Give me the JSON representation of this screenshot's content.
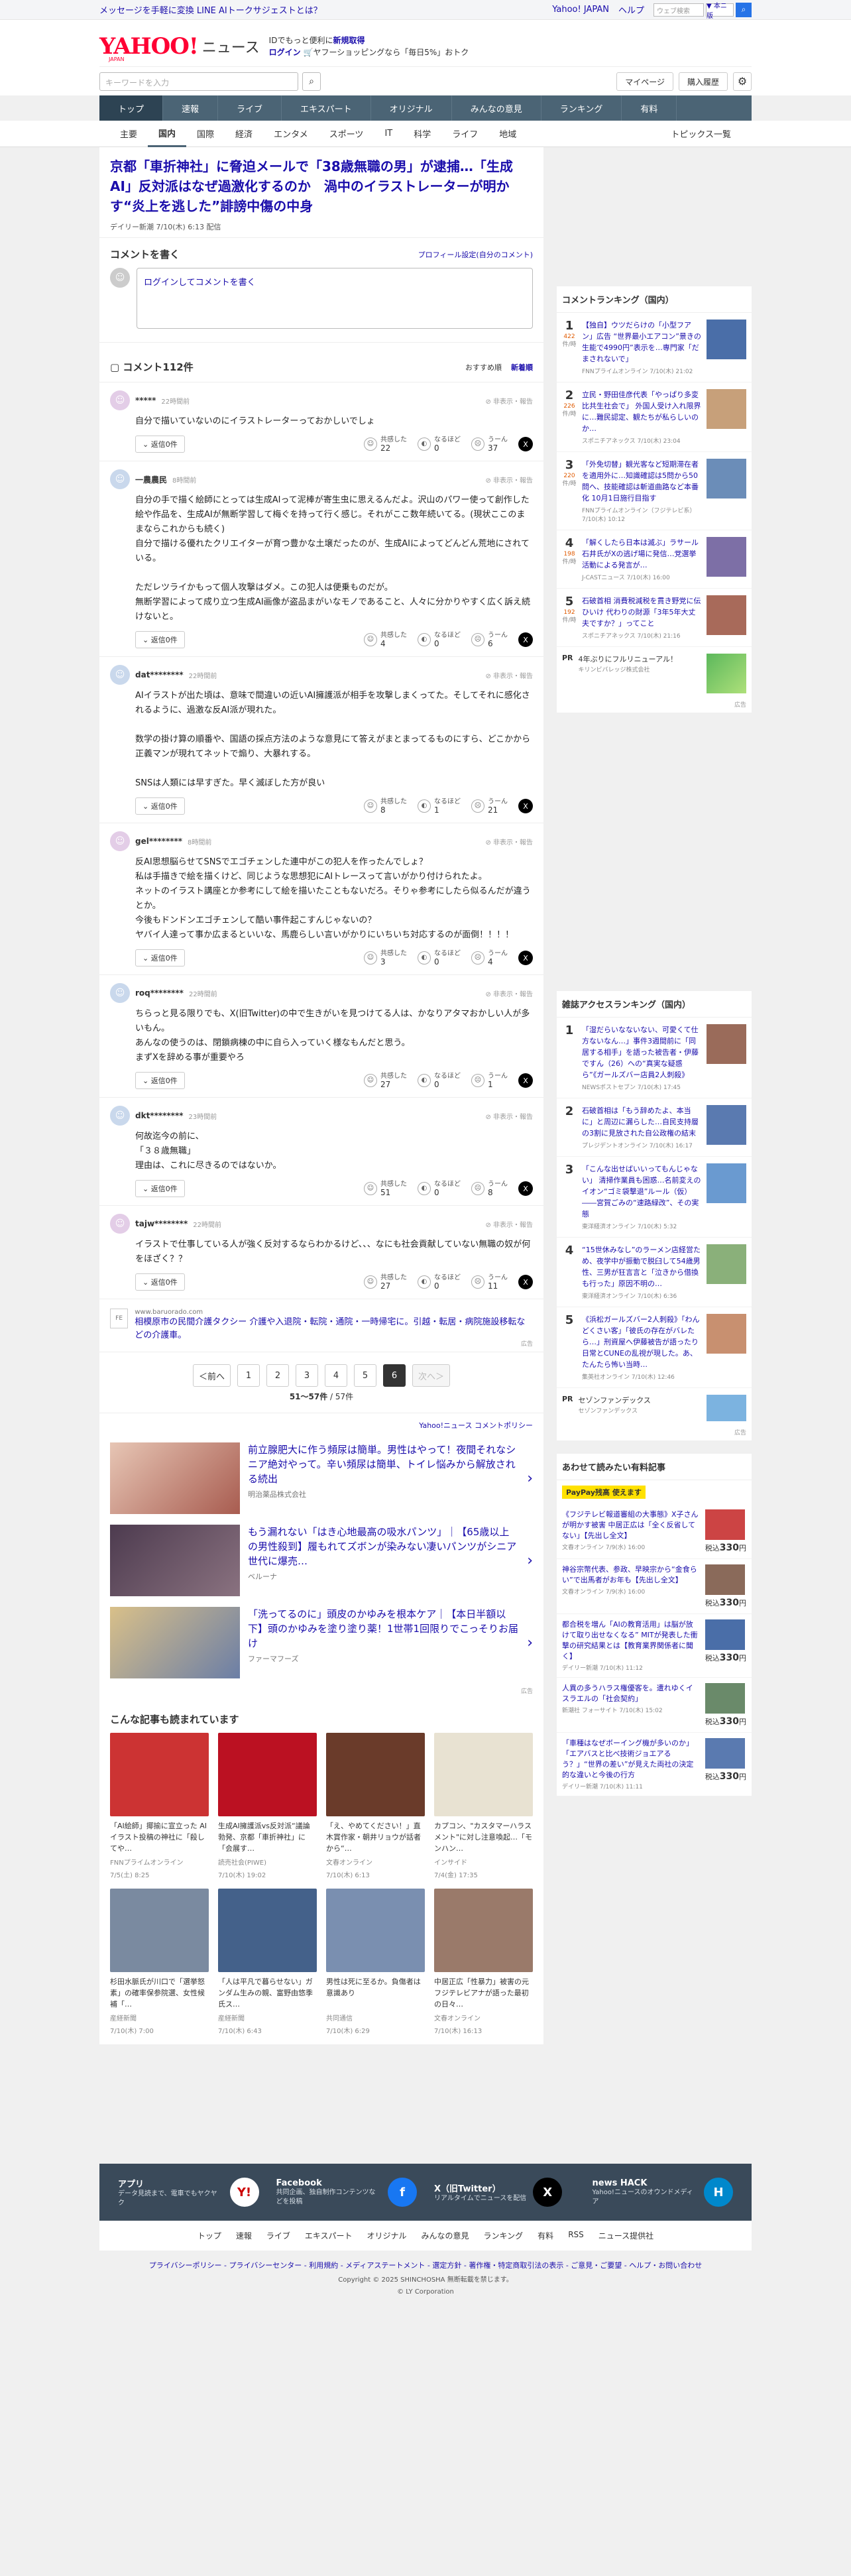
{
  "topbar": {
    "notice": "メッセージを手軽に変換 LINE AIトークサジェストとは？",
    "links": [
      "Yahoo! JAPAN",
      "ヘルプ"
    ],
    "search_placeholder": "ウェブ検索",
    "search_scope": "▼ 本ニ版",
    "search_go": "⌕"
  },
  "header": {
    "logo": "YAHOO!",
    "logo_sub": "JAPAN",
    "section": "ニュース",
    "promo_line1": "IDでもっと便利に",
    "promo_link1": "新規取得",
    "promo_line2_link": "ログイン",
    "promo_line2": "ヤフーショッピングなら「毎日5%」おトク",
    "search_placeholder": "キーワードを入力",
    "mypage": "マイページ",
    "history": "購入履歴"
  },
  "nav1": [
    "トップ",
    "速報",
    "ライブ",
    "エキスパート",
    "オリジナル",
    "みんなの意見",
    "ランキング",
    "有料"
  ],
  "nav2": [
    "主要",
    "国内",
    "国際",
    "経済",
    "エンタメ",
    "スポーツ",
    "IT",
    "科学",
    "ライフ",
    "地域"
  ],
  "nav2_right": "トピックス一覧",
  "article": {
    "title": "京都「車折神社」に脅迫メールで「38歳無職の男」が逮捕…「生成AI」反対派はなぜ過激化するのか　渦中のイラストレーターが明かす“炎上を逃した”誹謗中傷の中身",
    "source": "デイリー新潮 7/10(木) 6:13 配信"
  },
  "comment_write": {
    "title": "コメントを書く",
    "profile_link": "プロフィール設定(自分のコメント)",
    "placeholder": "ログインしてコメントを書く"
  },
  "comments_header": {
    "title": "コメント112件",
    "sort": [
      "おすすめ順",
      "新着順"
    ]
  },
  "labels": {
    "reply": "返信0件",
    "report": "非表示・報告",
    "agree": "共感した",
    "think": "なるほど",
    "hmm": "うーん"
  },
  "comments": [
    {
      "name": "*****",
      "time": "22時間前",
      "text": "自分で描いていないのにイラストレーターっておかしいでしょ",
      "v": [
        "22",
        "0",
        "37"
      ]
    },
    {
      "name": "一農農民",
      "time": "8時間前",
      "text": "自分の手で描く絵師にとっては生成AIって泥棒が寄生虫に思えるんだよ。沢山のパワー使って創作した絵や作品を、生成AIが無断学習して梅ぐを持って行く感じ。それがここ数年続いてる。(現状ここのままならこれからも続く)\n自分で描ける優れたクリエイターが育つ豊かな土壌だったのが、生成AIによってどんどん荒地にされている。\n\nただレツライかもって個人攻撃はダメ。この犯人は便乗ものだが。\n無断学習によって成り立つ生成AI画像が盗品まがいなモノであること、人々に分かりやすく広く訴え続けないと。",
      "v": [
        "4",
        "0",
        "6"
      ]
    },
    {
      "name": "dat********",
      "time": "22時間前",
      "text": "AIイラストが出た頃は、意味で間違いの近いAI擁護派が相手を攻撃しまくってた。そしてそれに感化されるように、過激な反AI派が現れた。\n\n数学の掛け算の順番や、国語の採点方法のような意見にて答えがまとまってるものにすら、どこかから正義マンが現れてネットで煽り、大暴れする。\n\nSNSは人類には早すぎた。早く滅ぼした方が良い",
      "v": [
        "8",
        "1",
        "21"
      ]
    },
    {
      "name": "gel********",
      "time": "8時間前",
      "text": "反AI思想脳らせてSNSでエゴチェンした連中がこの犯人を作ったんでしょ？\n私は手描きで絵を描くけど、同じような思想犯にAIトレースって言いがかり付けられたよ。\nネットのイラスト講座とか参考にして絵を描いたこともないだろ。そりゃ参考にしたら似るんだが違うとか。\n今後もドンドンエゴチェンして酷い事件起こすんじゃないの？\nヤバイ人達って事か広まるといいな、馬鹿らしい言いがかりにいちいち対応するのが面倒！！！！",
      "v": [
        "3",
        "0",
        "4"
      ]
    },
    {
      "name": "roq********",
      "time": "22時間前",
      "text": "ちらっと見る限りでも、X(旧Twitter)の中で生きがいを見つけてる人は、かなりアタマおかしい人が多いもん。\nあんなの使うのは、閉鎖病棟の中に自ら入っていく様なもんだと思う。\nまずXを辞める事が重要やろ",
      "v": [
        "27",
        "0",
        "1"
      ]
    },
    {
      "name": "dkt********",
      "time": "23時間前",
      "text": "何故迄今の前に、\n「３８歳無職」\n理由は、これに尽きるのではないか。",
      "v": [
        "51",
        "0",
        "8"
      ]
    },
    {
      "name": "tajw********",
      "time": "22時間前",
      "text": "イラストで仕事している人が強く反対するならわかるけど、、、なにも社会貢献していない無職の奴が何をほざく？？",
      "v": [
        "27",
        "0",
        "11"
      ]
    }
  ],
  "ad_comment": {
    "logo": "FE",
    "url": "www.baruorado.com",
    "title": "相模原市の民間介護タクシー 介護や入退院・転院・通院・一時帰宅に。引越・転居・病院施設移転などの介護車。",
    "label": "広告"
  },
  "pager": {
    "prev": "＜前へ",
    "pages": [
      "1",
      "2",
      "3",
      "4",
      "5",
      "6"
    ],
    "current": "6",
    "next": "次へ＞",
    "info_range": "51〜57件",
    "info_total": " / 57件"
  },
  "policy": "Yahoo!ニュース コメントポリシー",
  "sponsored": [
    {
      "title": "前立腺肥大に作う頻尿は簡単。男性はやって！夜間それなシニア絶対やって。辛い頻尿は簡単、トイレ悩みから解放される続出",
      "src": "明治薬品株式会社"
    },
    {
      "title": "もう漏れない「はき心地最高の吸水パンツ」｜【65歳以上の男性殺到】履もれてズボンが染みない凄いパンツがシニア世代に爆売…",
      "src": "ベルーナ"
    },
    {
      "title": "「洗ってるのに」頭皮のかゆみを根本ケア｜【本日半額以下】頭のかゆみを塗り塗り薬！1世帯1回限りでこっそりお届け",
      "src": "ファーマフーズ"
    }
  ],
  "sponsored_label": "広告",
  "read_more": {
    "title": "こんな記事も読まれています",
    "items": [
      {
        "t": "「AI絵師」揶揄に宣立った AIイラスト投稿の神社に「殺してや…",
        "m": "FNNプライムオンライン",
        "d": "7/5(土) 8:25",
        "c": "#c33"
      },
      {
        "t": "生成AI擁護派vs反対派“議論勃発、京都「車折神社」に「会展す…",
        "m": "読売社会(PIWE)",
        "d": "7/10(木) 19:02",
        "c": "#b12"
      },
      {
        "t": "「え、やめてください！」直木賞作家・朝井リョウが話者から“…",
        "m": "文春オンライン",
        "d": "7/10(木) 6:13",
        "c": "#6a3b2a"
      },
      {
        "t": "カプコン、\"カスタマーハラスメント\"に対し注意喚起…「モンハン…",
        "m": "インサイド",
        "d": "7/4(金) 17:35",
        "c": "#e8e2d2"
      },
      {
        "t": "杉田水脈氏が川口で「選挙怒素」の確率保参院選、女性候補「…",
        "m": "産経新聞",
        "d": "7/10(木) 7:00",
        "c": "#7a8aa0"
      },
      {
        "t": "「人は平凡で暮らせない」ガンダム生みの親、富野由悠季氏ス…",
        "m": "産経新聞",
        "d": "7/10(木) 6:43",
        "c": "#44618a"
      },
      {
        "t": "男性は死に至るか。負傷者は意識あり",
        "m": "共同通信",
        "d": "7/10(木) 6:29",
        "c": "#7a8fb0"
      },
      {
        "t": "中居正広「性暴力」被害の元フジテレビアナが語った最初の日々…",
        "m": "文春オンライン",
        "d": "7/10(木) 16:13",
        "c": "#9a7a6a"
      }
    ]
  },
  "ranking": {
    "title": "コメントランキング（国内）",
    "items": [
      {
        "n": "1",
        "c": "422",
        "t": "【独自】ウツだらけの「小型フアン」広告 “世界最小エアコン”景きの生能で4990円”表示を…専門家「だまされないで」",
        "m": "FNNプライムオンライン 7/10(木) 21:02"
      },
      {
        "n": "2",
        "c": "226",
        "t": "立民・野田佳彦代表「やっぱり多変比共生社会で」 外国人受け入れ限界に…難民認定、観たちが私らしいのか…",
        "m": "スポニチアネックス 7/10(木) 23:04"
      },
      {
        "n": "3",
        "c": "220",
        "t": "「外免切替」観光客など短期滞在者を適用外に…知識確認は5問から50問へ、技能確認は斬道曲路など本番化 10月1日施行目指す",
        "m": "FNNプライムオンライン（フジテレビ系） 7/10(木) 10:12"
      },
      {
        "n": "4",
        "c": "198",
        "t": "「解くしたら日本は滅ぶ」ラサール石井氏がXの逃げ場に発信…党選挙活動による発言が…",
        "m": "J-CASTニュース 7/10(木) 16:00"
      },
      {
        "n": "5",
        "c": "192",
        "t": "石破首相 消費税減税を貫き野党に伝ひいけ 代わりの財源「3年5年大丈夫ですか？」ってこと",
        "m": "スポニチアネックス 7/10(木) 21:16"
      }
    ],
    "per": "件/時",
    "pr_label": "PR",
    "pr_title": "4年ぶりにフルリニューアル！",
    "pr_src": "キリンビバレッジ株式会社",
    "ad_label": "広告"
  },
  "access": {
    "title": "雑誌アクセスランキング（国内）",
    "items": [
      {
        "n": "1",
        "t": "「湿だらいなないない、可愛くて仕方ないなん…」事件3週間前に「同居する相手」を語った被告者・伊藤ですん（26）への“真実な疑惑ら”《ガールズバー店員2人刺殺》",
        "m": "NEWSポストセブン 7/10(木) 17:45"
      },
      {
        "n": "2",
        "t": "石破首相は「もう辞めたよ、本当に」と周辺に漏らした…自民支持層の3割に見放された自公政権の結末",
        "m": "プレジデントオンライン 7/10(木) 16:17"
      },
      {
        "n": "3",
        "t": "「こんな出せばいいってもんじゃない」 清掃作業員も困惑…名前変えのイオン“ゴミ袋撃退”ルール（仮）――宮賀ごみの“速路緑改”、その実態",
        "m": "東洋経済オンライン 7/10(木) 5:32"
      },
      {
        "n": "4",
        "t": "“15世休みなし”のラーメン店経営ため、夜学中が振動で脱臼して54歳男性、三男が狂言言と「泣きから借換も行った」原因不明の…",
        "m": "東洋経済オンライン 7/10(木) 6:36"
      },
      {
        "n": "5",
        "t": "《浜松ガールズバー2人刺殺》「わんどくさい客」「彼氏の存在がバレたら…」刑資屋へ伊藤被告が語ったり日常とCUNEの乱視が現した。あ、たんたら怖い当時…",
        "m": "集英社オンライン 7/10(木) 12:46"
      }
    ],
    "pr_label": "PR",
    "pr_title": "セゾンファンデックス",
    "pr_src": "セゾンファンデックス",
    "ad_label": "広告"
  },
  "paid": {
    "title": "あわせて読みたい有料記事",
    "badge": "PayPay残高 使えます",
    "items": [
      {
        "t": "《フジテレビ報道審組の大事態》X子さんが明かす被害 中居正広は「全く反省してない」【先出し全文】",
        "m": "文春オンライン 7/9(水) 16:00",
        "p": "330"
      },
      {
        "t": "神谷宗幣代表、参政、早映宗から“金食らい”で出馬者がお年も【先出し全文】",
        "m": "文春オンライン 7/9(水) 16:00",
        "p": "330"
      },
      {
        "t": "都合税を増ん「AIの教育活用」は脳が放けて取り出せなくなる” MITが発表した衝撃の研究結果とは【教育業界関係者に聞く】",
        "m": "デイリー新潮 7/10(木) 11:12",
        "p": "330"
      },
      {
        "t": "人異の多うハラス権優客を。遭れゆくイスラエルの「社会契約」",
        "m": "新潮社 フォーサイト 7/10(木) 15:02",
        "p": "330"
      },
      {
        "t": "「車種はなぜボーイング機が多いのか」「エアバスと比べ技術ジョエアるう？」“世界の差い”が見えた両社の決定的な違いと今後の行方",
        "m": "デイリー新潮 7/10(木) 11:11",
        "p": "330"
      }
    ],
    "price_prefix": "税込",
    "price_suffix": "円"
  },
  "footer": {
    "apps": [
      {
        "t": "アプリ",
        "d": "データ見読まで、電車でもヤクヤク",
        "ic": "Y!",
        "bg": "#fff",
        "fg": "#c00"
      },
      {
        "t": "Facebook",
        "d": "共同企画、独自制作コンテンツなどを投稿",
        "ic": "f",
        "bg": "#1877f2",
        "fg": "#fff"
      },
      {
        "t": "X（旧Twitter）",
        "d": "リアルタイムでニュースを配信",
        "ic": "X",
        "bg": "#000",
        "fg": "#fff"
      },
      {
        "t": "news HACK",
        "d": "Yahoo!ニュースのオウンドメディア",
        "ic": "H",
        "bg": "#0088cc",
        "fg": "#fff"
      }
    ],
    "nav": [
      "トップ",
      "速報",
      "ライブ",
      "エキスパート",
      "オリジナル",
      "みんなの意見",
      "ランキング",
      "有料",
      "RSS",
      "ニュース提供社"
    ],
    "links": "プライバシーポリシー - プライバシーセンター - 利用規約 - メディアステートメント - 選定方針 - 著作権・特定商取引法の表示 - ご意見・ご要望 - ヘルプ・お問い合わせ",
    "copy1": "Copyright © 2025 SHINCHOSHA 無断転載を禁じます。",
    "copy2": "© LY Corporation"
  }
}
